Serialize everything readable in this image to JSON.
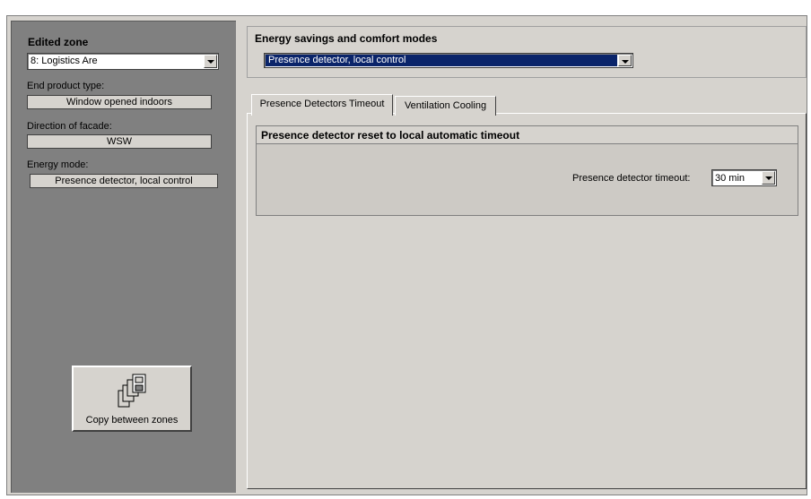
{
  "left_panel": {
    "edited_zone_heading": "Edited zone",
    "zone_selected": "8: Logistics Are",
    "end_product_label": "End product type:",
    "end_product_value": "Window opened indoors",
    "facade_label": "Direction of facade:",
    "facade_value": "WSW",
    "energy_mode_label": "Energy mode:",
    "energy_mode_value": "Presence detector, local control",
    "copy_button_label": "Copy between zones"
  },
  "top_panel": {
    "title": "Energy savings and comfort modes",
    "mode_selected": "Presence detector, local control"
  },
  "tabs": [
    {
      "label": "Presence Detectors Timeout",
      "active": true
    },
    {
      "label": "Ventilation Cooling",
      "active": false
    }
  ],
  "group": {
    "title": "Presence detector reset to local automatic timeout",
    "timeout_label": "Presence detector timeout:",
    "timeout_value": "30 min"
  },
  "colors": {
    "panel_gray": "#808080",
    "face": "#d6d3ce",
    "selection": "#0a246a"
  },
  "icons": {
    "copy": "copy-documents-icon",
    "dropdown": "chevron-down-icon"
  }
}
